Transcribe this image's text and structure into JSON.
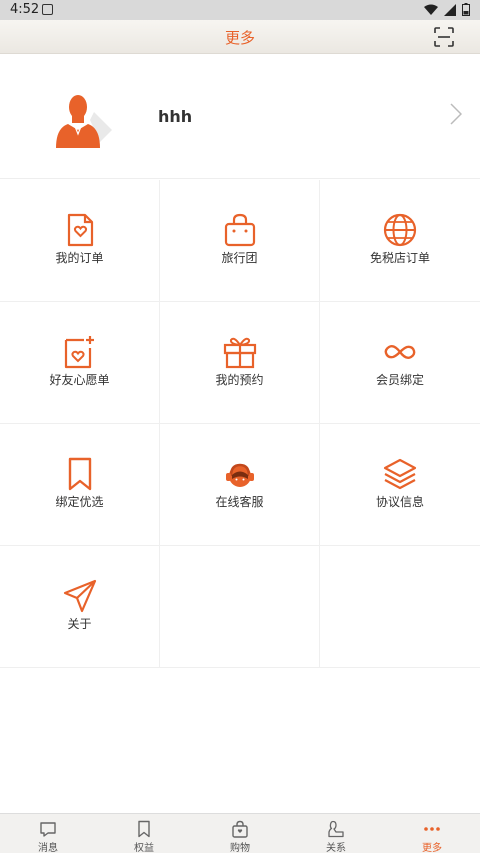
{
  "status_bar": {
    "time": "4:52"
  },
  "header": {
    "title": "更多"
  },
  "profile": {
    "username": "hhh"
  },
  "grid": {
    "items": [
      {
        "label": "我的订单",
        "icon": "order-heart-icon"
      },
      {
        "label": "旅行团",
        "icon": "bag-icon"
      },
      {
        "label": "免税店订单",
        "icon": "globe-icon"
      },
      {
        "label": "好友心愿单",
        "icon": "wishlist-icon"
      },
      {
        "label": "我的预约",
        "icon": "gift-icon"
      },
      {
        "label": "会员绑定",
        "icon": "infinity-icon"
      },
      {
        "label": "绑定优选",
        "icon": "bookmark-icon"
      },
      {
        "label": "在线客服",
        "icon": "customer-service-icon"
      },
      {
        "label": "协议信息",
        "icon": "layers-icon"
      },
      {
        "label": "关于",
        "icon": "paper-plane-icon"
      }
    ]
  },
  "bottom_nav": {
    "items": [
      {
        "label": "消息",
        "icon": "message-icon"
      },
      {
        "label": "权益",
        "icon": "bookmark-icon"
      },
      {
        "label": "购物",
        "icon": "shopping-bag-icon"
      },
      {
        "label": "关系",
        "icon": "relation-icon"
      },
      {
        "label": "更多",
        "icon": "more-dots-icon",
        "active": true
      }
    ]
  },
  "colors": {
    "accent": "#e8622a",
    "text": "#333333",
    "divider": "#efefef"
  }
}
